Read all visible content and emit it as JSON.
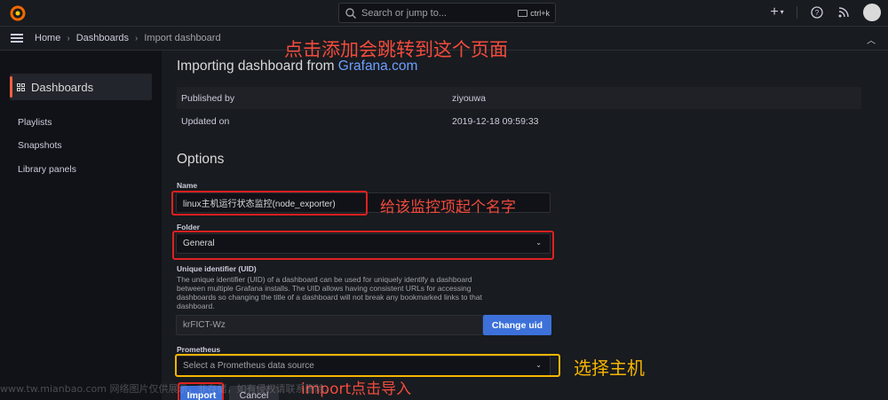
{
  "topbar": {
    "search_placeholder": "Search or jump to...",
    "shortcut": "ctrl+k",
    "plus": "+",
    "help_icon": "help-icon",
    "news_icon": "rss-icon"
  },
  "breadcrumb": {
    "items": [
      "Home",
      "Dashboards",
      "Import dashboard"
    ]
  },
  "sidebar": {
    "active": "Dashboards",
    "items": [
      "Playlists",
      "Snapshots",
      "Library panels"
    ]
  },
  "main": {
    "title_prefix": "Importing dashboard from ",
    "title_link": "Grafana.com",
    "info": [
      {
        "key": "Published by",
        "value": "ziyouwa"
      },
      {
        "key": "Updated on",
        "value": "2019-12-18 09:59:33"
      }
    ],
    "options_title": "Options",
    "name_label": "Name",
    "name_value": "linux主机运行状态监控(node_exporter)",
    "folder_label": "Folder",
    "folder_value": "General",
    "uid_label": "Unique identifier (UID)",
    "uid_help": "The unique identifier (UID) of a dashboard can be used for uniquely identify a dashboard between multiple Grafana installs. The UID allows having consistent URLs for accessing dashboards so changing the title of a dashboard will not break any bookmarked links to that dashboard.",
    "uid_value": "krFICT-Wz",
    "change_uid_label": "Change uid",
    "prometheus_label": "Prometheus",
    "prometheus_placeholder": "Select a Prometheus data source",
    "import_label": "Import",
    "cancel_label": "Cancel"
  },
  "annotations": {
    "page_note": "点击添加会跳转到这个页面",
    "name_note": "给该监控项起个名字",
    "host_note": "选择主机",
    "import_note": "import点击导入"
  },
  "watermark": "www.tw.mianbao.com 网络图片仅供展示，非存储，如有侵权请联系删除。",
  "colors": {
    "accent": "#3d71d9",
    "link": "#6e9fff",
    "annotation_red": "#e02020",
    "annotation_yellow": "#f6b500",
    "brand": "#f55f3e"
  }
}
